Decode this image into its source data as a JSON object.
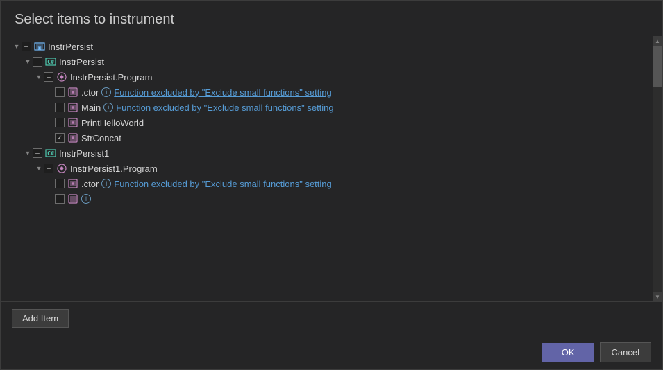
{
  "dialog": {
    "title": "Select items to instrument",
    "add_item_label": "Add Item",
    "ok_label": "OK",
    "cancel_label": "Cancel"
  },
  "tree": {
    "items": [
      {
        "id": "instrpersist-root",
        "indent": 0,
        "expander": "▼",
        "checkbox": "indeterminate",
        "icon_type": "assembly",
        "label": "InstrPersist",
        "info": false,
        "excluded": false
      },
      {
        "id": "instrpersist-namespace",
        "indent": 1,
        "expander": "▼",
        "checkbox": "indeterminate",
        "icon_type": "class",
        "label": "InstrPersist",
        "info": false,
        "excluded": false
      },
      {
        "id": "instrpersist-program",
        "indent": 2,
        "expander": "▼",
        "checkbox": "indeterminate",
        "icon_type": "namespace",
        "label": "InstrPersist.Program",
        "info": false,
        "excluded": false
      },
      {
        "id": "instrpersist-ctor",
        "indent": 3,
        "expander": null,
        "checkbox": "unchecked",
        "icon_type": "method",
        "label": ".ctor",
        "info": true,
        "excluded": true,
        "excluded_text": "Function excluded by \"Exclude small functions\" setting"
      },
      {
        "id": "instrpersist-main",
        "indent": 3,
        "expander": null,
        "checkbox": "unchecked",
        "icon_type": "method",
        "label": "Main",
        "info": true,
        "excluded": true,
        "excluded_text": "Function excluded by \"Exclude small functions\" setting"
      },
      {
        "id": "instrpersist-printhelloworld",
        "indent": 3,
        "expander": null,
        "checkbox": "unchecked",
        "icon_type": "method",
        "label": "PrintHelloWorld",
        "info": false,
        "excluded": false
      },
      {
        "id": "instrpersist-strconcat",
        "indent": 3,
        "expander": null,
        "checkbox": "checked",
        "icon_type": "method",
        "label": "StrConcat",
        "info": false,
        "excluded": false
      },
      {
        "id": "instrpersist1-root",
        "indent": 1,
        "expander": "▼",
        "checkbox": "indeterminate",
        "icon_type": "class",
        "label": "InstrPersist1",
        "info": false,
        "excluded": false
      },
      {
        "id": "instrpersist1-program",
        "indent": 2,
        "expander": "▼",
        "checkbox": "indeterminate",
        "icon_type": "namespace",
        "label": "InstrPersist1.Program",
        "info": false,
        "excluded": false
      },
      {
        "id": "instrpersist1-ctor",
        "indent": 3,
        "expander": null,
        "checkbox": "unchecked",
        "icon_type": "method",
        "label": ".ctor",
        "info": true,
        "excluded": true,
        "excluded_text": "Function excluded by \"Exclude small functions\" setting"
      },
      {
        "id": "instrpersist1-more",
        "indent": 3,
        "expander": null,
        "checkbox": "unchecked",
        "icon_type": "method",
        "label": "...",
        "info": true,
        "excluded": true,
        "excluded_text": ""
      }
    ]
  },
  "icons": {
    "assembly": "📦",
    "class": "C",
    "namespace": "⚙",
    "method": "◈",
    "check": "✓",
    "info": "i",
    "expand_down": "▼",
    "expand_right": "▶"
  }
}
